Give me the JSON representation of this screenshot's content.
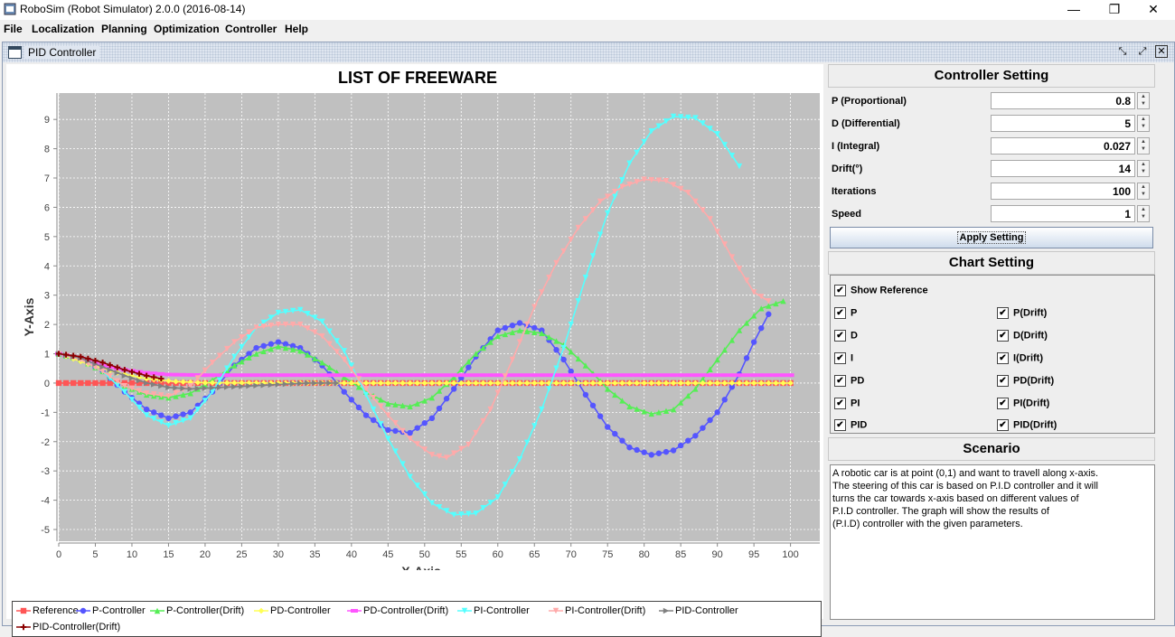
{
  "window": {
    "title": "RoboSim (Robot Simulator) 2.0.0 (2016-08-14)"
  },
  "menu": [
    "File",
    "Localization",
    "Planning",
    "Optimization",
    "Controller",
    "Help"
  ],
  "inner_window": {
    "title": "PID Controller"
  },
  "controller_setting": {
    "header": "Controller Setting",
    "fields": [
      {
        "label": "P (Proportional)",
        "value": "0.8"
      },
      {
        "label": "D (Differential)",
        "value": "5"
      },
      {
        "label": "I (Integral)",
        "value": "0.027"
      },
      {
        "label": "Drift(°)",
        "value": "14"
      },
      {
        "label": "Iterations",
        "value": "100"
      },
      {
        "label": "Speed",
        "value": "1"
      }
    ],
    "apply_label": "Apply Setting"
  },
  "chart_setting": {
    "header": "Chart Setting",
    "show_reference": "Show Reference",
    "left": [
      "P",
      "D",
      "I",
      "PD",
      "PI",
      "PID"
    ],
    "right": [
      "P(Drift)",
      "D(Drift)",
      "I(Drift)",
      "PD(Drift)",
      "PI(Drift)",
      "PID(Drift)"
    ]
  },
  "scenario": {
    "header": "Scenario",
    "lines": [
      "A robotic car is at point (0,1) and want to travell along x-axis.",
      " The steering of this car is based on P.I.D controller and it will",
      " turns the car towards x-axis based on different values of",
      "P.I.D controller. The graph will show the results of",
      "(P.I.D) controller with the given parameters."
    ]
  },
  "chart_data": {
    "type": "line",
    "title": "LIST OF FREEWARE",
    "xlabel": "X-Axis",
    "ylabel": "Y-Axis",
    "xlim": [
      0,
      104
    ],
    "ylim": [
      -5.4,
      9.9
    ],
    "x_ticks": [
      0,
      5,
      10,
      15,
      20,
      25,
      30,
      35,
      40,
      45,
      50,
      55,
      60,
      65,
      70,
      75,
      80,
      85,
      90,
      95,
      100
    ],
    "y_ticks": [
      -5,
      -4,
      -3,
      -2,
      -1,
      0,
      1,
      2,
      3,
      4,
      5,
      6,
      7,
      8,
      9
    ],
    "grid": true,
    "series": [
      {
        "name": "Reference",
        "color": "#ff5555",
        "marker": "square",
        "points": [
          [
            0,
            0
          ],
          [
            10,
            0
          ],
          [
            20,
            0
          ],
          [
            30,
            0
          ],
          [
            40,
            0
          ],
          [
            50,
            0
          ],
          [
            60,
            0
          ],
          [
            70,
            0
          ],
          [
            80,
            0
          ],
          [
            90,
            0
          ],
          [
            100,
            0
          ]
        ]
      },
      {
        "name": "P-Controller",
        "color": "#5555ff",
        "marker": "circle",
        "points": [
          [
            0,
            1
          ],
          [
            3,
            0.8
          ],
          [
            6,
            0.4
          ],
          [
            9,
            -0.3
          ],
          [
            12,
            -0.9
          ],
          [
            15,
            -1.2
          ],
          [
            18,
            -1
          ],
          [
            21,
            -0.3
          ],
          [
            24,
            0.6
          ],
          [
            27,
            1.2
          ],
          [
            30,
            1.4
          ],
          [
            33,
            1.2
          ],
          [
            36,
            0.6
          ],
          [
            39,
            -0.3
          ],
          [
            42,
            -1.1
          ],
          [
            45,
            -1.6
          ],
          [
            48,
            -1.7
          ],
          [
            51,
            -1.2
          ],
          [
            54,
            -0.2
          ],
          [
            57,
            0.9
          ],
          [
            60,
            1.8
          ],
          [
            63,
            2.05
          ],
          [
            66,
            1.8
          ],
          [
            69,
            0.8
          ],
          [
            72,
            -0.4
          ],
          [
            75,
            -1.5
          ],
          [
            78,
            -2.2
          ],
          [
            81,
            -2.45
          ],
          [
            84,
            -2.3
          ],
          [
            87,
            -1.8
          ],
          [
            90,
            -1
          ],
          [
            93,
            0.3
          ],
          [
            95,
            1.4
          ],
          [
            97,
            2.35
          ]
        ]
      },
      {
        "name": "P-Controller(Drift)",
        "color": "#55ee55",
        "marker": "triangle-up",
        "points": [
          [
            0,
            1
          ],
          [
            3,
            0.8
          ],
          [
            6,
            0.4
          ],
          [
            9,
            -0.1
          ],
          [
            12,
            -0.4
          ],
          [
            15,
            -0.5
          ],
          [
            18,
            -0.35
          ],
          [
            21,
            0.1
          ],
          [
            24,
            0.6
          ],
          [
            27,
            1
          ],
          [
            30,
            1.25
          ],
          [
            33,
            1.1
          ],
          [
            36,
            0.7
          ],
          [
            39,
            0.2
          ],
          [
            42,
            -0.3
          ],
          [
            45,
            -0.7
          ],
          [
            48,
            -0.8
          ],
          [
            51,
            -0.5
          ],
          [
            54,
            0.2
          ],
          [
            57,
            1
          ],
          [
            60,
            1.6
          ],
          [
            63,
            1.8
          ],
          [
            66,
            1.7
          ],
          [
            69,
            1.3
          ],
          [
            72,
            0.6
          ],
          [
            75,
            -0.2
          ],
          [
            78,
            -0.8
          ],
          [
            81,
            -1.05
          ],
          [
            84,
            -0.9
          ],
          [
            87,
            -0.2
          ],
          [
            90,
            0.8
          ],
          [
            93,
            1.8
          ],
          [
            96,
            2.55
          ],
          [
            99,
            2.8
          ]
        ]
      },
      {
        "name": "PD-Controller",
        "color": "#ffff55",
        "marker": "diamond",
        "points": [
          [
            0,
            1
          ],
          [
            4,
            0.65
          ],
          [
            8,
            0.35
          ],
          [
            12,
            0.15
          ],
          [
            16,
            0.05
          ],
          [
            20,
            0.01
          ],
          [
            30,
            0
          ],
          [
            40,
            0
          ],
          [
            50,
            0
          ],
          [
            60,
            0
          ],
          [
            70,
            0
          ],
          [
            80,
            0
          ],
          [
            90,
            0
          ],
          [
            100,
            0
          ]
        ]
      },
      {
        "name": "PD-Controller(Drift)",
        "color": "#ff55ff",
        "marker": "rect",
        "points": [
          [
            0,
            1
          ],
          [
            3,
            0.85
          ],
          [
            6,
            0.6
          ],
          [
            9,
            0.45
          ],
          [
            12,
            0.35
          ],
          [
            15,
            0.29
          ],
          [
            20,
            0.27
          ],
          [
            30,
            0.27
          ],
          [
            40,
            0.27
          ],
          [
            50,
            0.27
          ],
          [
            60,
            0.27
          ],
          [
            70,
            0.27
          ],
          [
            80,
            0.27
          ],
          [
            90,
            0.27
          ],
          [
            100,
            0.27
          ]
        ]
      },
      {
        "name": "PI-Controller",
        "color": "#55ffff",
        "marker": "triangle-down",
        "points": [
          [
            0,
            1
          ],
          [
            3,
            0.8
          ],
          [
            6,
            0.4
          ],
          [
            9,
            -0.3
          ],
          [
            12,
            -1.1
          ],
          [
            15,
            -1.45
          ],
          [
            18,
            -1.2
          ],
          [
            21,
            -0.3
          ],
          [
            24,
            0.9
          ],
          [
            27,
            1.9
          ],
          [
            30,
            2.4
          ],
          [
            33,
            2.5
          ],
          [
            36,
            2.1
          ],
          [
            39,
            1.1
          ],
          [
            42,
            -0.4
          ],
          [
            45,
            -1.9
          ],
          [
            48,
            -3.2
          ],
          [
            51,
            -4.1
          ],
          [
            54,
            -4.5
          ],
          [
            57,
            -4.45
          ],
          [
            60,
            -3.9
          ],
          [
            63,
            -2.6
          ],
          [
            66,
            -0.9
          ],
          [
            69,
            1.2
          ],
          [
            72,
            3.6
          ],
          [
            75,
            5.8
          ],
          [
            78,
            7.5
          ],
          [
            81,
            8.6
          ],
          [
            84,
            9.1
          ],
          [
            87,
            9.05
          ],
          [
            90,
            8.5
          ],
          [
            93,
            7.4
          ]
        ]
      },
      {
        "name": "PI-Controller(Drift)",
        "color": "#ffaaaa",
        "marker": "triangle-down",
        "points": [
          [
            0,
            1
          ],
          [
            3,
            0.8
          ],
          [
            6,
            0.4
          ],
          [
            9,
            -0.1
          ],
          [
            12,
            -0.35
          ],
          [
            15,
            -0.45
          ],
          [
            18,
            -0.1
          ],
          [
            21,
            0.7
          ],
          [
            24,
            1.4
          ],
          [
            27,
            1.9
          ],
          [
            30,
            2
          ],
          [
            33,
            2
          ],
          [
            36,
            1.6
          ],
          [
            39,
            0.8
          ],
          [
            42,
            -0.2
          ],
          [
            45,
            -1.1
          ],
          [
            48,
            -1.9
          ],
          [
            51,
            -2.45
          ],
          [
            53,
            -2.55
          ],
          [
            56,
            -2.1
          ],
          [
            59,
            -0.9
          ],
          [
            62,
            0.8
          ],
          [
            65,
            2.6
          ],
          [
            68,
            4.1
          ],
          [
            71,
            5.3
          ],
          [
            74,
            6.2
          ],
          [
            77,
            6.7
          ],
          [
            80,
            6.95
          ],
          [
            83,
            6.9
          ],
          [
            86,
            6.5
          ],
          [
            89,
            5.6
          ],
          [
            92,
            4.3
          ],
          [
            95,
            3.1
          ],
          [
            97,
            2.8
          ]
        ]
      },
      {
        "name": "PID-Controller",
        "color": "#808080",
        "marker": "triangle-right",
        "points": [
          [
            0,
            1
          ],
          [
            3,
            0.85
          ],
          [
            6,
            0.55
          ],
          [
            9,
            0.25
          ],
          [
            12,
            0
          ],
          [
            15,
            -0.15
          ],
          [
            18,
            -0.2
          ],
          [
            22,
            -0.15
          ],
          [
            26,
            -0.1
          ],
          [
            30,
            -0.05
          ],
          [
            34,
            0
          ],
          [
            38,
            0
          ]
        ]
      },
      {
        "name": "PID-Controller(Drift)",
        "color": "#8b0000",
        "marker": "cross",
        "points": [
          [
            0,
            1
          ],
          [
            3,
            0.9
          ],
          [
            6,
            0.7
          ],
          [
            9,
            0.45
          ],
          [
            12,
            0.25
          ],
          [
            14,
            0.15
          ]
        ]
      }
    ]
  }
}
